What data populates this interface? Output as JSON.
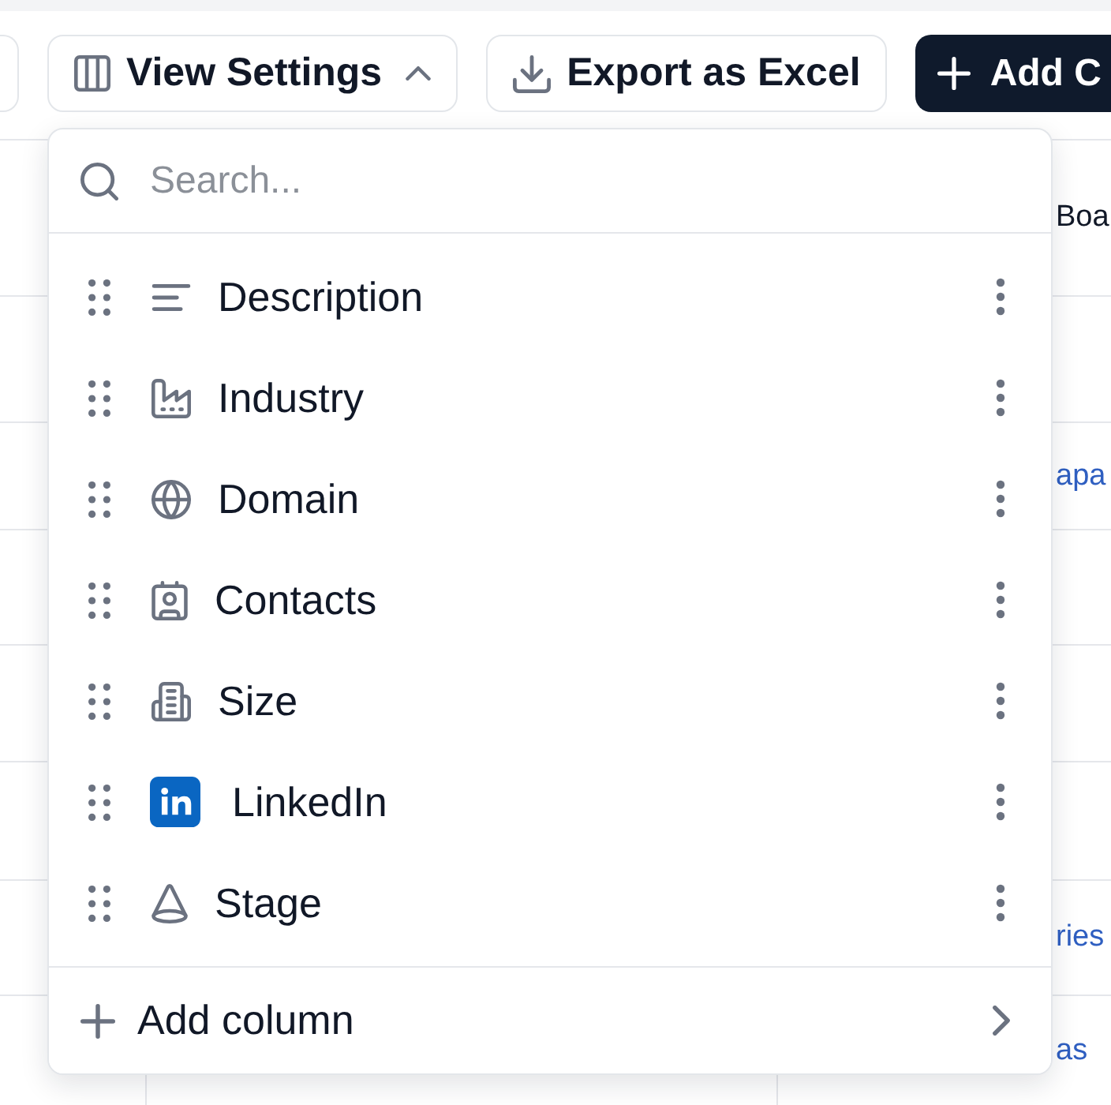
{
  "toolbar": {
    "buttons": [
      {
        "kind": "edge"
      },
      {
        "kind": "outline",
        "label": "View Settings",
        "expanded": true
      },
      {
        "kind": "outline",
        "label": "Export as Excel"
      },
      {
        "kind": "primary",
        "label": "Add C"
      }
    ]
  },
  "column_menu": {
    "search": {
      "placeholder": "Search..."
    },
    "items": [
      {
        "label": "Description"
      },
      {
        "label": "Industry"
      },
      {
        "label": "Domain"
      },
      {
        "label": "Contacts"
      },
      {
        "label": "Size"
      },
      {
        "label": "LinkedIn"
      },
      {
        "label": "Stage"
      }
    ],
    "footer": {
      "label": "Add column"
    }
  },
  "table": {
    "rows": [
      {
        "column_3": {
          "text": "Boa",
          "kind": "text"
        }
      },
      {},
      {
        "column_3": {
          "text": "apa",
          "kind": "link"
        }
      },
      {},
      {},
      {},
      {
        "column_3": {
          "text": "ries",
          "kind": "link"
        }
      },
      {
        "column_3": {
          "text": "as",
          "kind": "link"
        }
      }
    ]
  }
}
